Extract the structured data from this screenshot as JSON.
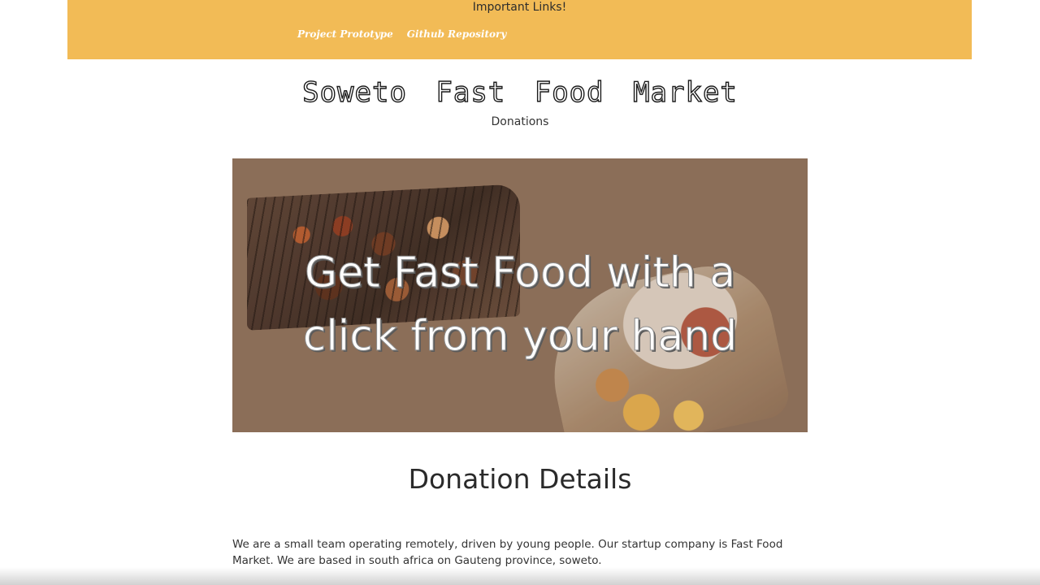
{
  "banner": {
    "title": "Important Links!",
    "links": [
      {
        "label": "Project Prototype"
      },
      {
        "label": "Github Repository"
      }
    ],
    "color": "#f2bb56"
  },
  "header": {
    "site_title": "Soweto Fast Food Market",
    "subtitle": "Donations"
  },
  "hero": {
    "headline": "Get Fast Food with a click from your hand",
    "background_color": "#8b6e58"
  },
  "main": {
    "heading": "Donation Details",
    "paragraph": "We are a small team operating remotely, driven by young people. Our startup company is Fast Food Market. We are based in south africa on Gauteng province, soweto."
  }
}
